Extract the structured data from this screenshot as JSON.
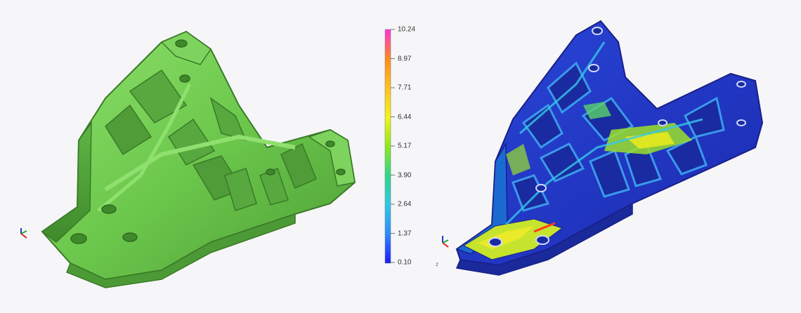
{
  "legend": {
    "values": [
      "10.24",
      "8.97",
      "7.71",
      "6.44",
      "5.17",
      "3.90",
      "2.64",
      "1.37",
      "0.10"
    ],
    "colors": [
      "#ff33dd",
      "#ff8a1e",
      "#ffc21e",
      "#f2f21e",
      "#8fe81e",
      "#2ed68a",
      "#2ec8e8",
      "#2e8aff",
      "#1a1aff"
    ]
  },
  "views": {
    "left": {
      "model_color": "#6dc850",
      "triad_icon": "axis-triad-icon"
    },
    "right": {
      "model_colors": [
        "#2036c8",
        "#1a8fe0",
        "#4cd27a",
        "#e8e81e",
        "#ff6a1e"
      ],
      "triad_icon": "axis-triad-icon",
      "axis_letter": "z"
    }
  }
}
